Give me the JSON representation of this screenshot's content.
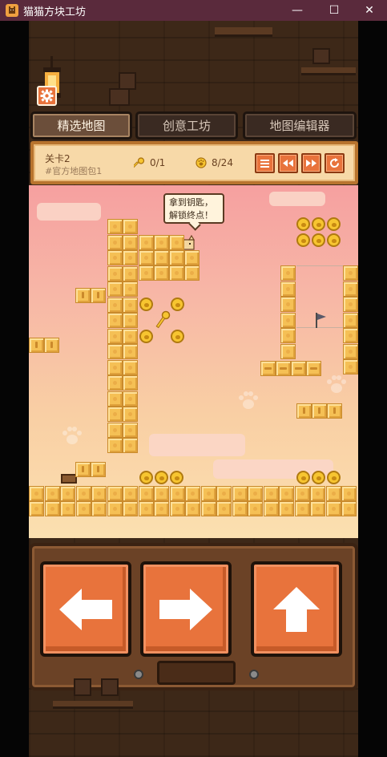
{
  "window": {
    "title": "猫猫方块工坊",
    "minimize": "—",
    "maximize": "☐",
    "close": "✕"
  },
  "tabs": [
    {
      "label": "精选地图",
      "active": true
    },
    {
      "label": "创意工坊",
      "active": false
    },
    {
      "label": "地图编辑器",
      "active": false
    }
  ],
  "level": {
    "title": "关卡2",
    "subtitle": "#官方地图包1",
    "keys": "0/1",
    "coins": "8/24"
  },
  "header_buttons": [
    "menu-icon",
    "rewind-icon",
    "fast-forward-icon",
    "restart-icon"
  ],
  "speech_bubble": {
    "line1": "拿到钥匙，",
    "line2": "解锁终点！"
  },
  "controls": [
    "left-arrow-icon",
    "right-arrow-icon",
    "up-arrow-icon"
  ],
  "colors": {
    "accent": "#e8733c",
    "tile": "#f5c055",
    "coin": "#f7c530",
    "titlebar": "#5a2a3c"
  }
}
